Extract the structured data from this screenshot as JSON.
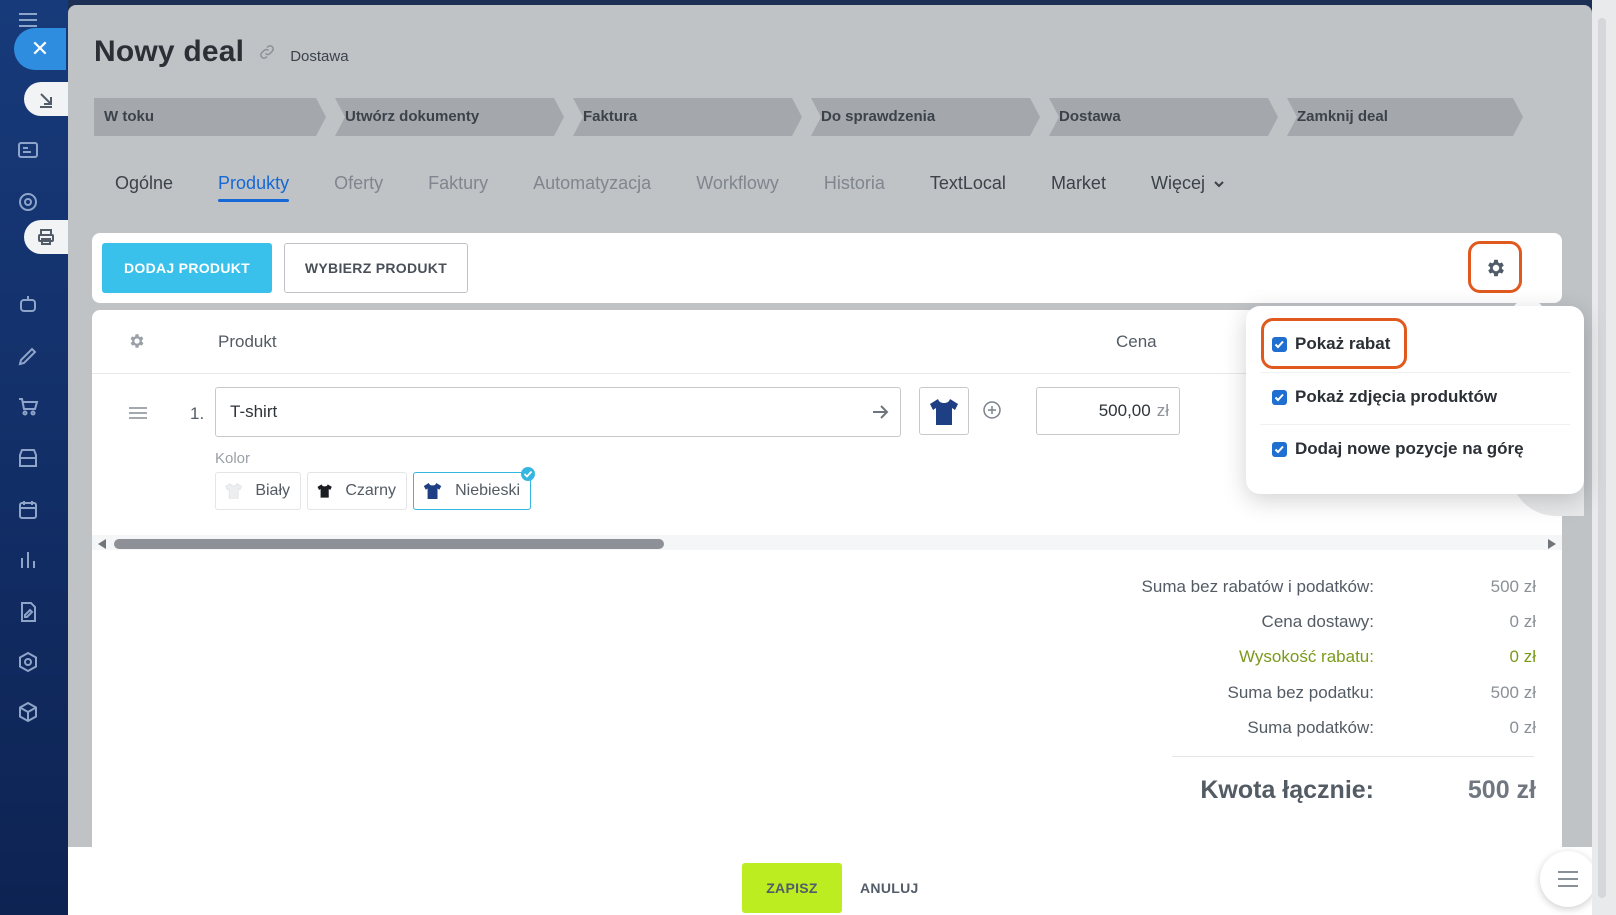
{
  "page": {
    "title": "Nowy deal",
    "current_stage": "Dostawa"
  },
  "stages": [
    "W toku",
    "Utwórz dokumenty",
    "Faktura",
    "Do sprawdzenia",
    "Dostawa",
    "Zamknij deal"
  ],
  "tabs": [
    {
      "label": "Ogólne"
    },
    {
      "label": "Produkty"
    },
    {
      "label": "Oferty"
    },
    {
      "label": "Faktury"
    },
    {
      "label": "Automatyzacja"
    },
    {
      "label": "Workflowy"
    },
    {
      "label": "Historia"
    },
    {
      "label": "TextLocal"
    },
    {
      "label": "Market"
    },
    {
      "label": "Więcej"
    }
  ],
  "toolbar": {
    "add_product": "DODAJ PRODUKT",
    "choose_product": "WYBIERZ PRODUKT"
  },
  "table": {
    "col_product": "Produkt",
    "col_price": "Cena"
  },
  "row": {
    "number": "1.",
    "name": "T-shirt",
    "price": "500,00",
    "currency": "zł",
    "color_label": "Kolor",
    "variants": [
      "Biały",
      "Czarny",
      "Niebieski"
    ]
  },
  "totals": {
    "rows": [
      {
        "label": "Suma bez rabatów i podatków:",
        "value": "500 zł"
      },
      {
        "label": "Cena dostawy:",
        "value": "0 zł"
      },
      {
        "label": "Wysokość rabatu:",
        "value": "0 zł"
      },
      {
        "label": "Suma bez podatku:",
        "value": "500 zł"
      },
      {
        "label": "Suma podatków:",
        "value": "0 zł"
      }
    ],
    "grand_label": "Kwota łącznie:",
    "grand_value": "500 zł"
  },
  "popup": {
    "items": [
      {
        "label": "Pokaż rabat",
        "checked": true
      },
      {
        "label": "Pokaż zdjęcia produktów",
        "checked": true
      },
      {
        "label": "Dodaj nowe pozycje na górę",
        "checked": true
      }
    ]
  },
  "footer": {
    "save": "ZAPISZ",
    "cancel": "ANULUJ"
  },
  "colors": {
    "accent_blue": "#1668d6",
    "primary_button": "#39c1ec",
    "save_button": "#bbed21",
    "highlight": "#e05a1f",
    "discount_text": "#7a9a1c"
  }
}
